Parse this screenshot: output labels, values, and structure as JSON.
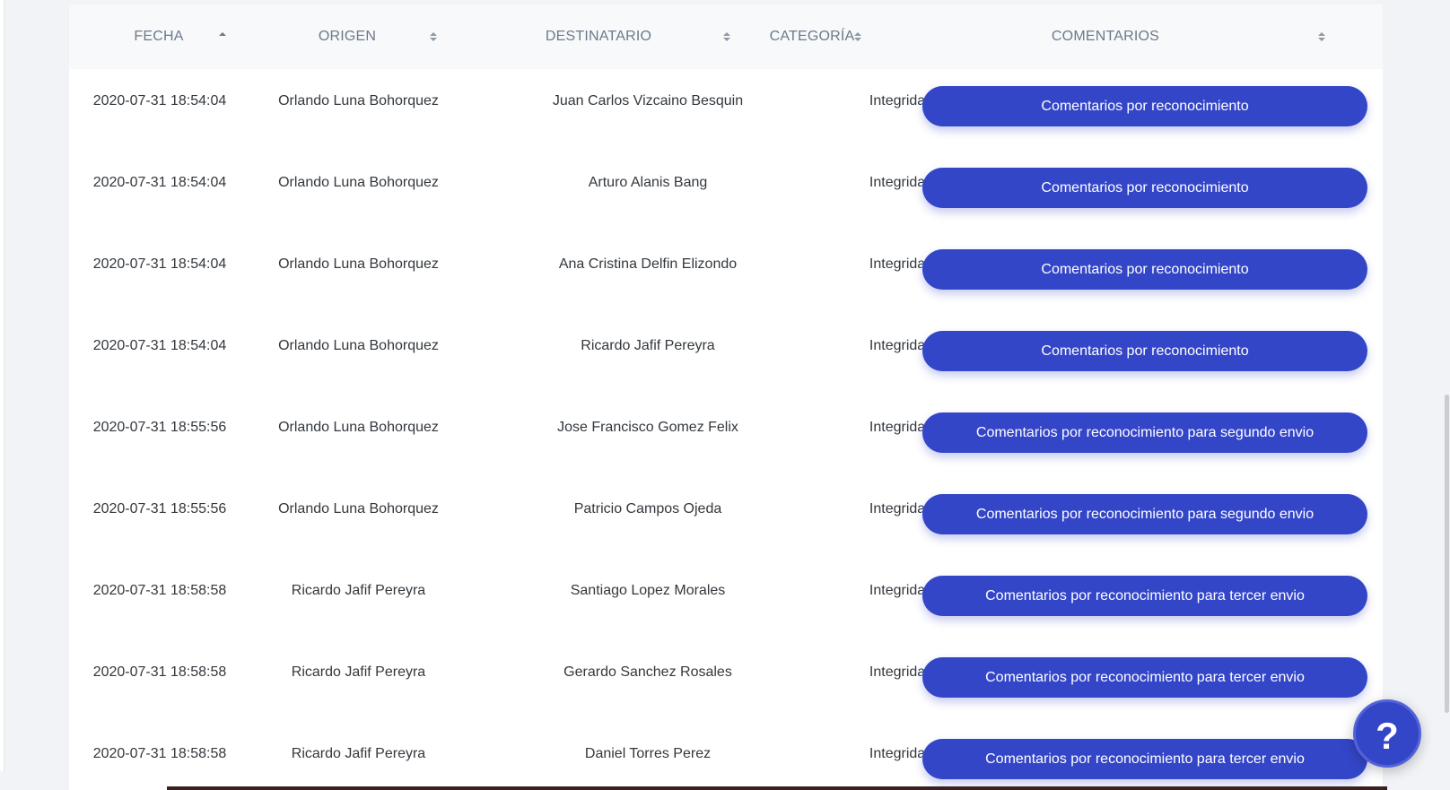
{
  "table": {
    "headers": {
      "fecha": "FECHA",
      "origen": "ORIGEN",
      "destinatario": "DESTINATARIO",
      "categoria": "CATEGORÍA",
      "comentarios": "COMENTARIOS"
    },
    "sort": {
      "fecha": "ascending",
      "origen": "unsorted",
      "destinatario": "unsorted",
      "categoria": "unsorted",
      "comentarios": "unsorted"
    },
    "rows": [
      {
        "fecha": "2020-07-31 18:54:04",
        "origen": "Orlando Luna Bohorquez",
        "destinatario": "Juan Carlos Vizcaino Besquin",
        "categoria": "Integridad",
        "comentario": "Comentarios por reconocimiento"
      },
      {
        "fecha": "2020-07-31 18:54:04",
        "origen": "Orlando Luna Bohorquez",
        "destinatario": "Arturo Alanis Bang",
        "categoria": "Integridad",
        "comentario": "Comentarios por reconocimiento"
      },
      {
        "fecha": "2020-07-31 18:54:04",
        "origen": "Orlando Luna Bohorquez",
        "destinatario": "Ana Cristina Delfin Elizondo",
        "categoria": "Integridad",
        "comentario": "Comentarios por reconocimiento"
      },
      {
        "fecha": "2020-07-31 18:54:04",
        "origen": "Orlando Luna Bohorquez",
        "destinatario": "Ricardo Jafif Pereyra",
        "categoria": "Integridad",
        "comentario": "Comentarios por reconocimiento"
      },
      {
        "fecha": "2020-07-31 18:55:56",
        "origen": "Orlando Luna Bohorquez",
        "destinatario": "Jose Francisco Gomez Felix",
        "categoria": "Integridad",
        "comentario": "Comentarios por reconocimiento para segundo envio"
      },
      {
        "fecha": "2020-07-31 18:55:56",
        "origen": "Orlando Luna Bohorquez",
        "destinatario": "Patricio Campos Ojeda",
        "categoria": "Integridad",
        "comentario": "Comentarios por reconocimiento para segundo envio"
      },
      {
        "fecha": "2020-07-31 18:58:58",
        "origen": "Ricardo Jafif Pereyra",
        "destinatario": "Santiago Lopez Morales",
        "categoria": "Integridad",
        "comentario": "Comentarios por reconocimiento para tercer envio"
      },
      {
        "fecha": "2020-07-31 18:58:58",
        "origen": "Ricardo Jafif Pereyra",
        "destinatario": "Gerardo Sanchez Rosales",
        "categoria": "Integridad",
        "comentario": "Comentarios por reconocimiento para tercer envio"
      },
      {
        "fecha": "2020-07-31 18:58:58",
        "origen": "Ricardo Jafif Pereyra",
        "destinatario": "Daniel Torres Perez",
        "categoria": "Integridad",
        "comentario": "Comentarios por reconocimiento para tercer envio"
      }
    ]
  },
  "help_button": {
    "label": "?",
    "icon": "question-mark-icon"
  },
  "colors": {
    "accent": "#3446c8",
    "header_text": "#6b7a8a",
    "body_text": "#33383d",
    "header_bg": "#f8f9fa"
  }
}
